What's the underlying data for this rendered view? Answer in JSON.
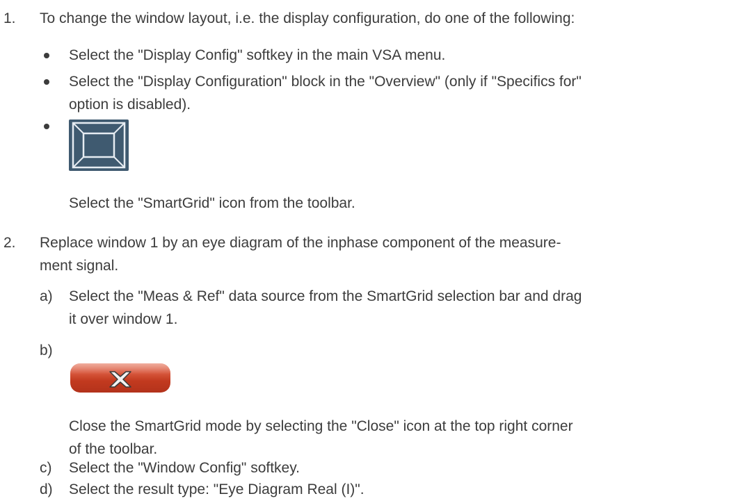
{
  "steps": [
    {
      "number": "1.",
      "line1": "To change the window layout, i.e. the display configuration, do one of the following:",
      "bullets": [
        {
          "text": "Select the \"Display Config\" softkey in the main VSA menu."
        },
        {
          "line1": "Select the \"Display Configuration\" block in the \"Overview\" (only if \"Specifics for\"",
          "line2": "option is disabled)."
        },
        {
          "icon": "smartgrid-icon",
          "caption": "Select the \"SmartGrid\" icon from the toolbar."
        }
      ]
    },
    {
      "number": "2.",
      "line1": "Replace window 1 by an eye diagram of the inphase component of the measure-",
      "line2": "ment signal.",
      "substeps": [
        {
          "label": "a)",
          "line1": "Select the \"Meas & Ref\" data source from the SmartGrid selection bar and drag",
          "line2": "it over window 1."
        },
        {
          "label": "b)",
          "icon": "close-icon",
          "line1": "Close the SmartGrid mode by selecting the \"Close\" icon at the top right corner",
          "line2": "of the toolbar."
        },
        {
          "label": "c)",
          "text": "Select the \"Window Config\" softkey."
        },
        {
          "label": "d)",
          "text": "Select the result type: \"Eye Diagram Real (I)\"."
        }
      ]
    }
  ],
  "colors": {
    "text": "#3c3c3c",
    "smartgrid_bg": "#3f5a70",
    "close_red": "#c23a1f"
  }
}
